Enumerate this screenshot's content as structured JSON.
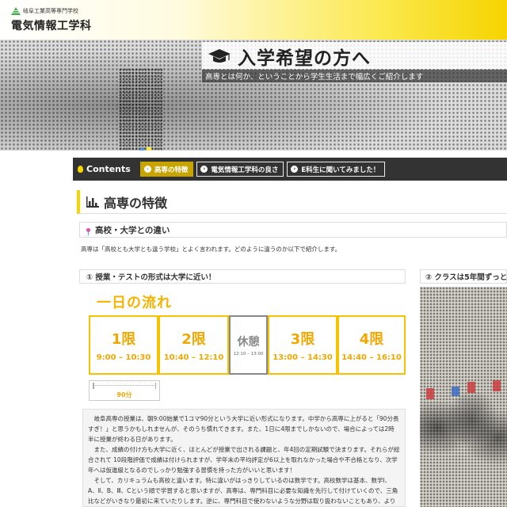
{
  "header": {
    "school_name": "岐阜工業高等専門学校",
    "department": "電気情報工学科"
  },
  "hero": {
    "title": "入学希望の方へ",
    "subtitle": "高専とは何か、ということから学生生活まで幅広くご紹介します",
    "icon": "graduation-cap-icon"
  },
  "nav": {
    "label": "Contents",
    "items": [
      {
        "label": "高専の特徴",
        "active": true
      },
      {
        "label": "電気情報工学科の良さ",
        "active": false
      },
      {
        "label": "E科生に聞いてみました！",
        "active": false
      }
    ]
  },
  "section": {
    "title": "高専の特徴",
    "icon": "bar-chart-icon",
    "subsection_title": "高校・大学との違い",
    "intro": "高専は「高校とも大学とも違う学校」とよく言われます。どのように違うのか以下で紹介します。"
  },
  "panel1": {
    "heading": "① 授業・テストの形式は大学に近い！",
    "flow_title": "一日の流れ",
    "periods": [
      {
        "name": "1限",
        "time": "9:00 – 10:30"
      },
      {
        "name": "2限",
        "time": "10:40 – 12:10"
      },
      {
        "name": "3限",
        "time": "13:00 – 14:30"
      },
      {
        "name": "4限",
        "time": "14:40 – 16:10"
      }
    ],
    "break": {
      "name": "休憩",
      "time": "12:10 – 13:00"
    },
    "duration_label": "90分",
    "paragraphs": [
      "岐阜高専の授業は、朝9:00始業で1コマ90分という大学に近い形式になります。中学から高専に上がると「90分長すぎ！」と思うかもしれませんが、そのうち慣れてきます。また、1日に4限までしかないので、場合によっては2時半に授業が終わる日があります。",
      "また、成績の付け方も大学に近く、ほとんどが授業で出される課題と、年4回の定期試験で決まります。それらが総合されて 10段階評価で成績は付けられますが、学年末の平均評定が6以上を取れなかった場合や不合格となり、次学年へは仮進級となるのでしっかり勉強する習慣を持った方がいいと思います！",
      "そして、カリキュラムも高校と違います。特に違いがはっきりしているのは数学です。高校数学は基本、数学Ⅰ、A、Ⅱ、B、Ⅲ、Cという順で学習すると思いますが、高専は、専門科目に必要な知識を先行して付けていくので、三角比などがいきなり最初に来ていたりします。逆に、専門科目で使わないような分野は取り扱わないこともあり、より実践的に学ぶことができます。"
    ]
  },
  "panel2": {
    "heading": "② クラスは5年間ずっと"
  }
}
